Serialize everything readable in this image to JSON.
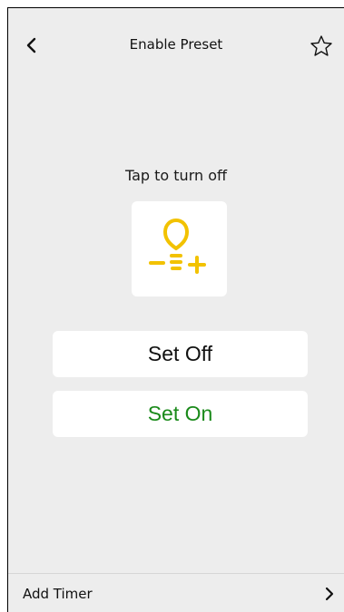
{
  "header": {
    "title": "Enable Preset",
    "back_icon": "chevron-left-icon",
    "favorite_icon": "star-outline-icon"
  },
  "main": {
    "instruction": "Tap to turn off",
    "tile_icon": "lightbulb-plus-icon",
    "tile_icon_color": "#f2c200",
    "set_off_label": "Set Off",
    "set_on_label": "Set On",
    "set_on_color": "#1a8a1a"
  },
  "footer": {
    "label": "Add Timer",
    "arrow_icon": "chevron-right-icon"
  }
}
